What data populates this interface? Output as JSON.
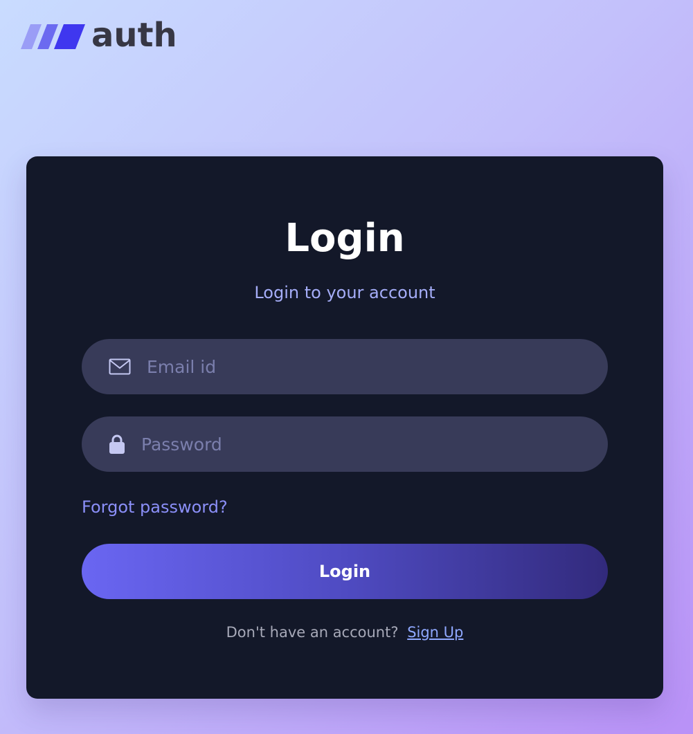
{
  "brand": {
    "name": "auth",
    "logo_icon": "three-slash-stripes-icon",
    "stripe_colors": [
      "#9a9df6",
      "#6b6af0",
      "#3f37ef"
    ]
  },
  "login_card": {
    "title": "Login",
    "subtitle": "Login to your account",
    "email": {
      "icon": "mail-icon",
      "placeholder": "Email id",
      "value": ""
    },
    "password": {
      "icon": "lock-icon",
      "placeholder": "Password",
      "value": ""
    },
    "forgot_password_label": "Forgot password?",
    "login_button_label": "Login",
    "signup_prompt": "Don't have an account?",
    "signup_link_label": "Sign Up"
  },
  "colors": {
    "card_background": "#131829",
    "input_background": "#383b59",
    "accent": "#6a66f2",
    "link": "#8b8ff8"
  }
}
